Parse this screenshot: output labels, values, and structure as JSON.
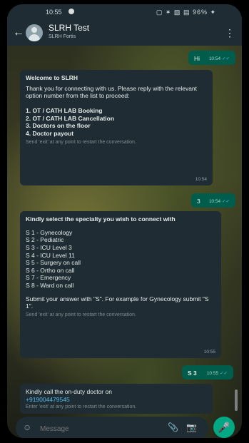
{
  "status": {
    "time": "10:55",
    "right": "▢ ✶ ▧ ▤ 96% ✦"
  },
  "header": {
    "title": "SLRH Test",
    "subtitle": "SLRH Fortis"
  },
  "messages": [
    {
      "dir": "out",
      "text": "Hi",
      "time": "10:54"
    },
    {
      "dir": "in",
      "title": "Welcome to SLRH",
      "intro": "Thank you for connecting with us. Please reply with the relevant option number from the list to proceed:",
      "options": [
        "1. OT / CATH LAB Booking",
        "2. OT / CATH LAB Cancellation",
        "3. Doctors on the floor",
        "4. Doctor payout"
      ],
      "footer": "Send 'exit' at any point to restart the conversation.",
      "time": "10:54"
    },
    {
      "dir": "out",
      "text": "3",
      "time": "10:54"
    },
    {
      "dir": "in",
      "title": "Kindly select the specialty you wish to connect with",
      "items": [
        "S 1 - Gynecology",
        "S 2 - Pediatric",
        "S 3 - ICU Level 3",
        "S 4 - ICU Level 11",
        "S 5 - Surgery on call",
        "S 6 - Ortho on call",
        "S 7 - Emergency",
        "S 8 - Ward on call"
      ],
      "instruction": "Submit your answer with \"S\". For example for Gynecology submit \"S 1\".",
      "footer": "Send 'exit' at any point to restart the conversation.",
      "time": "10:55"
    },
    {
      "dir": "out",
      "text": "S 3",
      "time": "10:55"
    },
    {
      "dir": "in",
      "line1": "Kindly call the on-duty doctor on",
      "phone": "+919004479545",
      "footer": "Enter 'exit' at any point to restart the conversation."
    }
  ],
  "composer": {
    "placeholder": "Message"
  },
  "colors": {
    "incoming": "#1f2c34",
    "outgoing": "#005c4b",
    "accent": "#00a884",
    "link": "#53bdeb"
  },
  "icons": [
    "back-arrow-icon",
    "menu-kebab-icon",
    "emoji-icon",
    "attach-icon",
    "camera-icon",
    "mic-icon",
    "read-ticks-icon"
  ]
}
